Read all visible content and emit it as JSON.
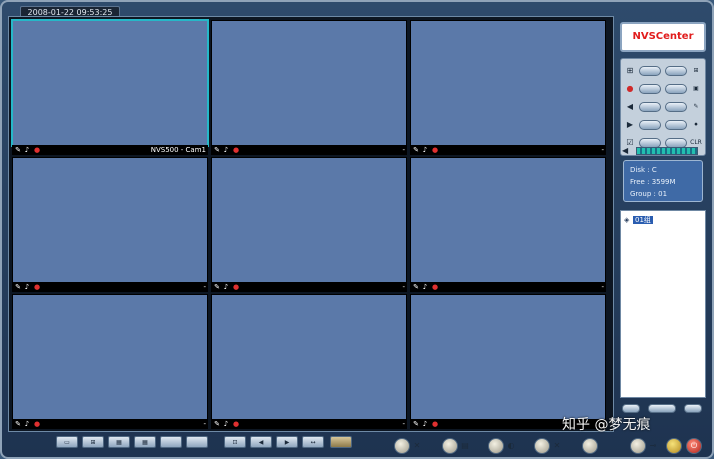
{
  "header": {
    "datetime": "2008-01-22 09:53:25"
  },
  "cells": [
    {
      "label": "NVS500 - Cam1",
      "selected": true,
      "scene": "camera-feed-parking-top"
    },
    {
      "label": "-",
      "selected": false,
      "scene": "camera-feed-street"
    },
    {
      "label": "-",
      "selected": false,
      "scene": "camera-feed-garage-interior"
    },
    {
      "label": "-",
      "selected": false,
      "scene": "camera-feed-garage-entrance"
    },
    {
      "label": "-",
      "selected": false,
      "scene": "empty"
    },
    {
      "label": "-",
      "selected": false,
      "scene": "empty"
    },
    {
      "label": "-",
      "selected": false,
      "scene": "empty"
    },
    {
      "label": "-",
      "selected": false,
      "scene": "empty"
    },
    {
      "label": "-",
      "selected": false,
      "scene": "empty"
    }
  ],
  "panel": {
    "logo": "NVSCenter",
    "controls": [
      {
        "left_icon": "ptz-icon",
        "right_icon": "ptz-icon"
      },
      {
        "left_icon": "record-icon",
        "right_icon": "snapshot-icon"
      },
      {
        "left_icon": "speaker-icon",
        "right_icon": "draw-icon"
      },
      {
        "left_icon": "play-icon",
        "right_icon": "rec-icon"
      },
      {
        "left_icon": "checkbox-icon",
        "right_label": "CLR"
      }
    ],
    "disk": {
      "disk_label": "Disk :",
      "disk_value": "C",
      "free_label": "Free :",
      "free_value": "3599M",
      "group_label": "Group :",
      "group_value": "01"
    },
    "tree": {
      "group_label": "01组"
    }
  },
  "watermark": "知乎 @梦无痕",
  "colors": {
    "empty_view": "#5b79a9",
    "selected_border": "#26b8c8",
    "logo_text": "#e11c1c"
  }
}
